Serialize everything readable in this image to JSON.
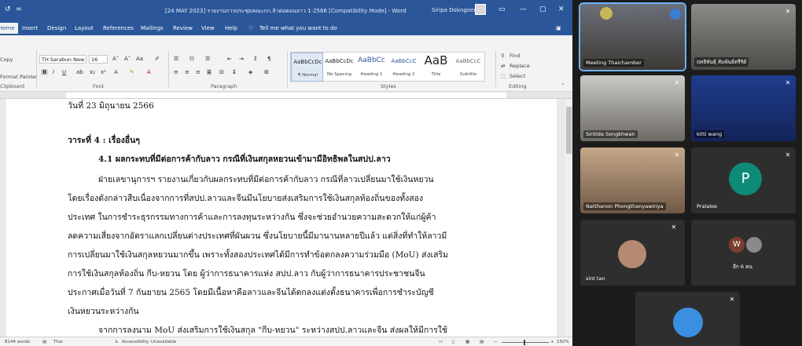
{
  "word": {
    "title": "[24 MAY 2023] รายงานการประชุมคณะกก.ล้าต่อตอนลาว 1-2566 [Compatibility Mode] - Word",
    "user": "Siripa Dokngoen",
    "menu": [
      "Home",
      "Insert",
      "Design",
      "Layout",
      "References",
      "Mailings",
      "Review",
      "View",
      "Help"
    ],
    "tellme": "Tell me what you want to do",
    "clipboard": {
      "copy": "Copy",
      "painter": "Format Painter",
      "label": "Clipboard"
    },
    "font": {
      "name": "TH Sarabun New",
      "size": "16",
      "label": "Font"
    },
    "paragraph_label": "Paragraph",
    "styles": [
      {
        "sample": "AaBbCcDc",
        "name": "¶ Normal"
      },
      {
        "sample": "AaBbCcDc",
        "name": "No Spacing"
      },
      {
        "sample": "AaBbCc",
        "name": "Heading 1"
      },
      {
        "sample": "AaBbCcC",
        "name": "Heading 2"
      },
      {
        "sample": "AaB",
        "name": "Title"
      },
      {
        "sample": "AaBbCcC",
        "name": "Subtitle"
      }
    ],
    "styles_label": "Styles",
    "editing": {
      "find": "Find",
      "replace": "Replace",
      "select": "Select",
      "label": "Editing"
    },
    "doc": {
      "line_date": "วันที่ 23 มิถุนายน 2566",
      "agenda": "วาระที่ 4 : เรื่องอื่นๆ",
      "heading": "4.1 ผลกระทบที่มีต่อการค้ากับลาว กรณีที่เงินสกุลหยวนเข้ามามีอิทธิพลในสปป.ลาว",
      "para": [
        "ฝ่ายเลขานุการฯ รายงานเกี่ยวกับผลกระทบที่มีต่อการค้ากับลาว กรณีที่ลาวเปลี่ยนมาใช้เงินหยวน",
        "โดยเรื่องดังกล่าวสืบเนื่องจากการที่สปป.ลาวและจีนมีนโยบายส่งเสริมการใช้เงินสกุลท้องถิ่นของทั้งสอง",
        "ประเทศ ในการชำระธุรกรรมทางการค้าและการลงทุนระหว่างกัน ซึ่งจะช่วยอำนวยความสะดวกให้แก่ผู้ค้า",
        "ลดความเสี่ยงจากอัตราแลกเปลี่ยนต่างประเทศที่ผันผวน ซึ่งนโยบายนี้มีมานานหลายปีแล้ว แต่สิ่งที่ทำให้ลาวมี",
        "การเปลี่ยนมาใช้เงินสกุลหยวนมากขึ้น เพราะทั้งสองประเทศได้มีการทำข้อตกลงความร่วมมือ (MoU) ส่งเสริม",
        "การใช้เงินสกุลท้องถิ่น กีบ-หยวน โดย ผู้ว่าการธนาคารแห่ง สปป.ลาว กับผู้ว่าการธนาคารประชาชนจีน",
        "ประกาศเมื่อวันที่ 7 กันยายน 2565 โดยมีเนื้อหาคือลาวและจีนได้ตกลงแต่งตั้งธนาคารเพื่อการชำระบัญชี",
        "เงินหยวนระหว่างกัน",
        "จากการลงนาม MoU ส่งเสริมการใช้เงินสกุล \"กีบ-หยวน\" ระหว่างสปป.ลาวและจีน ส่งผลให้มีการใช้"
      ]
    },
    "status": {
      "words": "8144 words",
      "lang": "Thai",
      "access": "Accessibility: Unavailable",
      "zoom": "150%"
    }
  },
  "participants": [
    {
      "name": "Meeting Thaichamber",
      "active": true
    },
    {
      "name": "ฤทธิพันธุ์ สัมพันธ์ตรีรัต์",
      "muted": true
    },
    {
      "name": "Siritida Songkhwan",
      "muted": true
    },
    {
      "name": "kitti wang",
      "muted": true
    },
    {
      "name": "Natthanon Phongthanyawiriya",
      "muted": true
    },
    {
      "name": "Pralalee",
      "initial": "P",
      "muted": true
    },
    {
      "name": "sint tan",
      "muted": true
    },
    {
      "name": "อีก 6 คน",
      "initial": "W"
    },
    {
      "name": "",
      "muted": true
    }
  ],
  "colors": {
    "word_blue": "#2b579a",
    "zoom_active": "#6fb3ff",
    "avatar_p": "#0e8b76"
  }
}
